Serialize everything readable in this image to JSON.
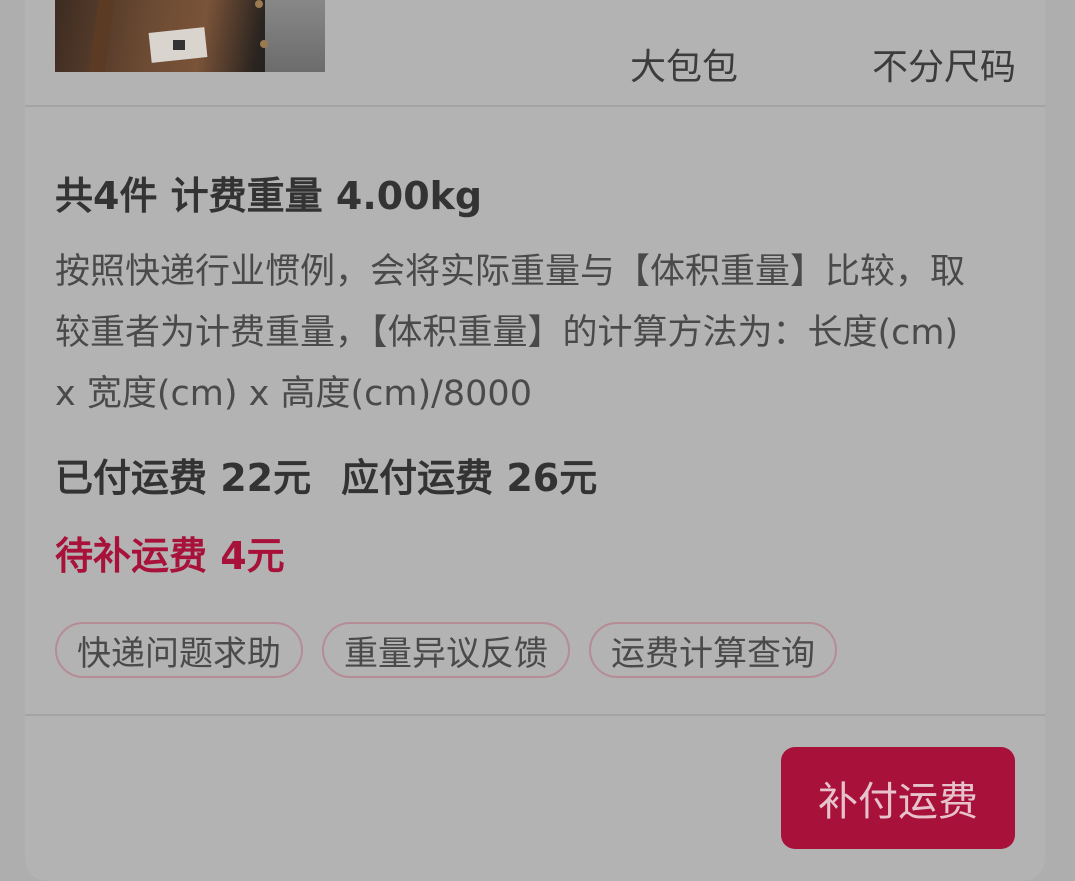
{
  "product": {
    "thumbnail_icon": "handbag-photo",
    "color": "大包包",
    "size": "不分尺码"
  },
  "summary": {
    "text": "共4件 计费重量 4.00kg"
  },
  "note": {
    "text": "按照快递行业惯例，会将实际重量与【体积重量】比较，取较重者为计费重量，【体积重量】的计算方法为：长度(cm) x 宽度(cm) x 高度(cm)/8000"
  },
  "fees": {
    "paid": "已付运费 22元",
    "payable": "应付运费 26元",
    "due": "待补运费 4元"
  },
  "chips": [
    {
      "label": "快递问题求助"
    },
    {
      "label": "重量异议反馈"
    },
    {
      "label": "运费计算查询"
    }
  ],
  "actions": {
    "pay_label": "补付运费"
  },
  "colors": {
    "accent": "#a8113a",
    "text": "#333333"
  }
}
